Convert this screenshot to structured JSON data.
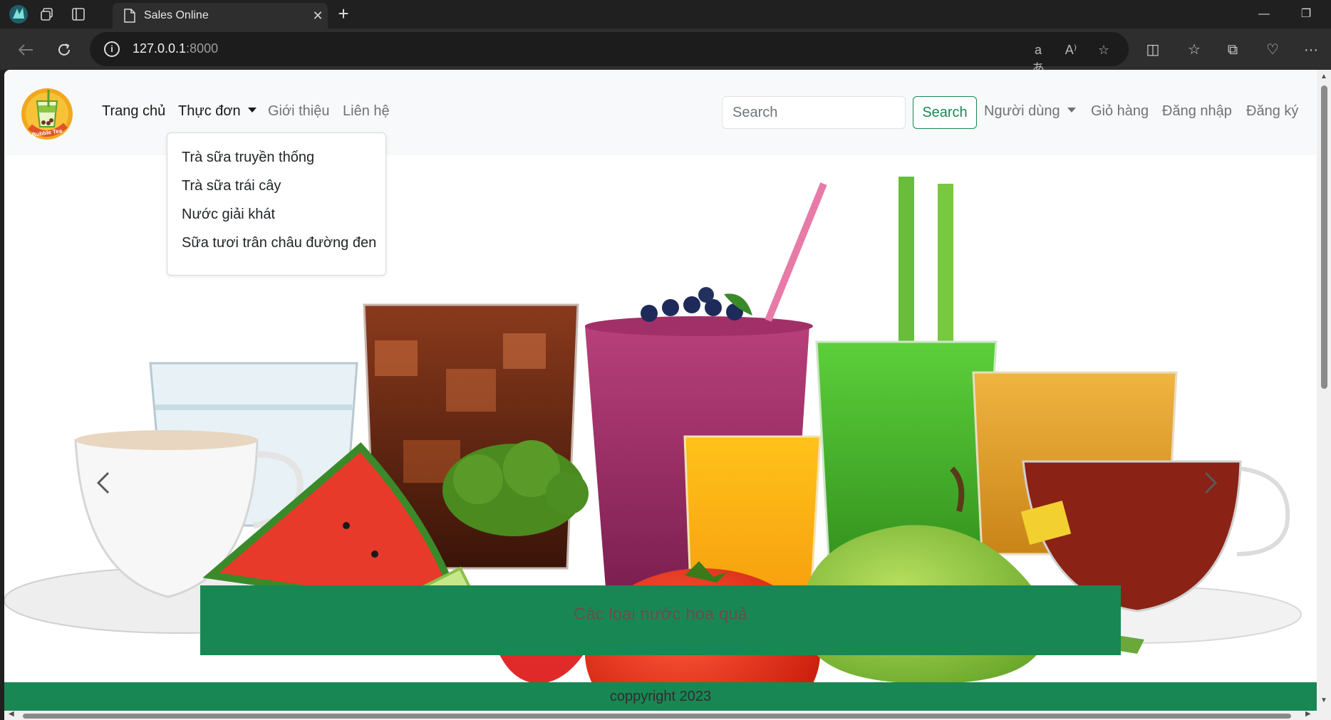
{
  "browser": {
    "tab_title": "Sales Online",
    "url_host": "127.0.0.1",
    "url_port": ":8000"
  },
  "site": {
    "logo_text": "Bubble Tea",
    "nav": {
      "home": "Trang chủ",
      "menu": "Thực đơn",
      "about": "Giới thiệu",
      "contact": "Liên hệ",
      "user": "Người dùng",
      "cart": "Giỏ hàng",
      "login": "Đăng nhập",
      "register": "Đăng ký"
    },
    "search": {
      "placeholder": "Search",
      "button": "Search"
    },
    "menu_dropdown": [
      "Trà sữa truyền thống",
      "Trà sữa trái cây",
      "Nước giải khát",
      "Sữa tươi trân châu đường đen"
    ],
    "carousel": {
      "caption": "Các loại nước hoa quả"
    },
    "footer": "coppyright 2023"
  },
  "colors": {
    "brand_green": "#198754",
    "navbar_bg": "#f8f9fa",
    "chrome_dark": "#202020"
  }
}
